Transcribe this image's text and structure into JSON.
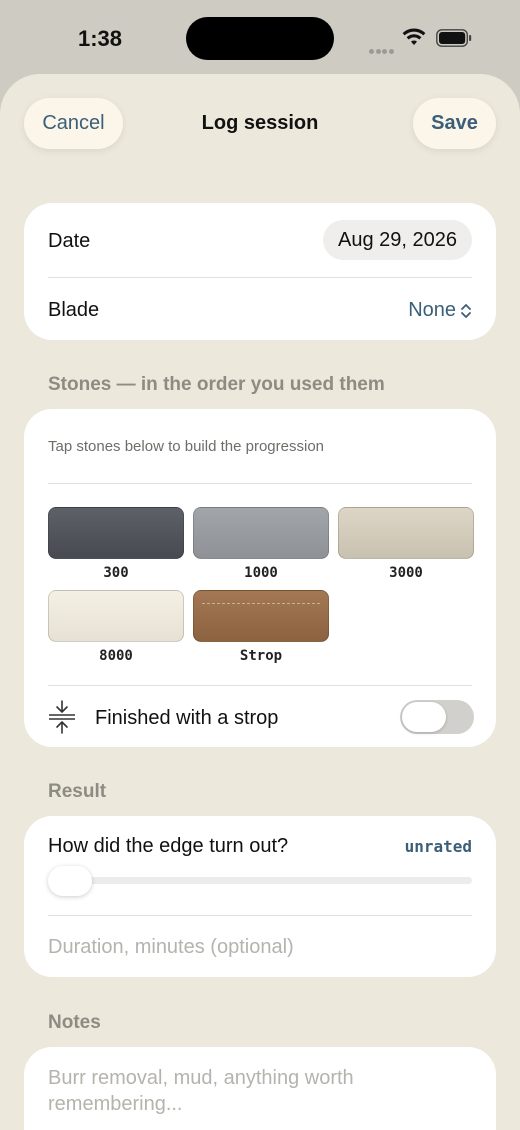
{
  "status_bar": {
    "time": "1:38"
  },
  "nav": {
    "cancel": "Cancel",
    "title": "Log session",
    "save": "Save"
  },
  "details": {
    "date_label": "Date",
    "date_value": "Aug 29, 2026",
    "blade_label": "Blade",
    "blade_value": "None"
  },
  "stones": {
    "header": "Stones — in the order you used them",
    "hint": "Tap stones below to build the progression",
    "items": [
      {
        "label": "300",
        "color": "#4f5259"
      },
      {
        "label": "1000",
        "color": "#979a9f"
      },
      {
        "label": "3000",
        "color": "#d4ccbb"
      },
      {
        "label": "8000",
        "color": "#ede9dc"
      },
      {
        "label": "Strop",
        "color": "#9a6e4b"
      }
    ],
    "strop_toggle_label": "Finished with a strop",
    "strop_toggle_on": false
  },
  "result": {
    "header": "Result",
    "question": "How did the edge turn out?",
    "rating": "unrated",
    "duration_placeholder": "Duration, minutes (optional)"
  },
  "notes": {
    "header": "Notes",
    "placeholder": "Burr removal, mud, anything worth remembering..."
  },
  "colors": {
    "accent": "#3b5f78",
    "sheet": "#ece8dc"
  }
}
